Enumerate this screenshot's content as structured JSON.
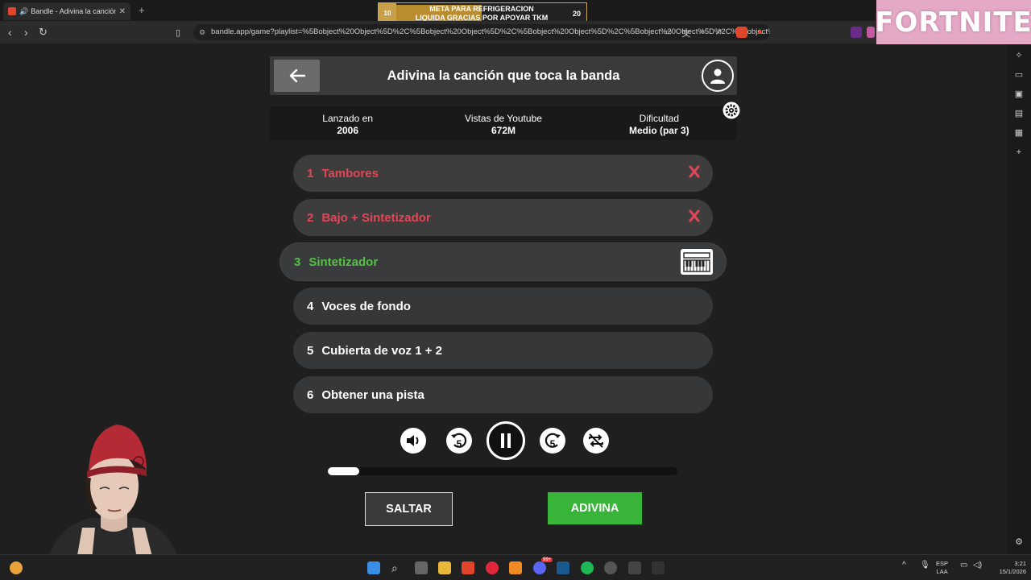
{
  "browser": {
    "tab_title": "Bandle - Adivina la canción, u",
    "url": "bandle.app/game?playlist=%5Bobject%20Object%5D%2C%5Bobject%20Object%5D%2C%5Bobject%20Object%5D%2C%5Bobject%20Object%5D%2C%5Bobject%..."
  },
  "banner": {
    "left_number": "10",
    "line1": "META PARA REFRIGERACION",
    "line2": "LIQUIDA GRACIAS POR APOYAR TKM",
    "right_number": "20"
  },
  "overlay_logo": "FORTNITE",
  "game": {
    "title": "Adivina la canción que toca la banda",
    "stats": [
      {
        "label": "Lanzado en",
        "value": "2006"
      },
      {
        "label": "Vistas de Youtube",
        "value": "672M"
      },
      {
        "label": "Dificultad",
        "value": "Medio (par 3)"
      }
    ],
    "tracks": [
      {
        "num": "1",
        "label": "Tambores",
        "state": "failed"
      },
      {
        "num": "2",
        "label": "Bajo + Sintetizador",
        "state": "failed"
      },
      {
        "num": "3",
        "label": "Sintetizador",
        "state": "active"
      },
      {
        "num": "4",
        "label": "Voces de fondo",
        "state": "pending"
      },
      {
        "num": "5",
        "label": "Cubierta de voz 1 + 2",
        "state": "pending"
      },
      {
        "num": "6",
        "label": "Obtener una pista",
        "state": "pending"
      }
    ],
    "rewind_label": "5",
    "forward_label": "5",
    "progress_fraction": 0.09,
    "skip_label": "SALTAR",
    "guess_label": "ADIVINA"
  },
  "taskbar": {
    "lang_top": "ESP",
    "lang_bottom": "LAA",
    "time": "3:21",
    "date": "15/1/2026",
    "discord_badge": "99+"
  },
  "colors": {
    "failed": "#e24656",
    "active": "#55c244",
    "guess_button": "#38b539"
  }
}
